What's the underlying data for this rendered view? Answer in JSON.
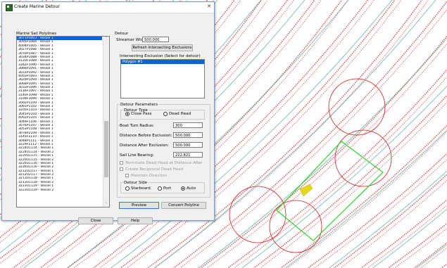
{
  "dialog": {
    "title": "Create Marine Detour",
    "close_glyph": "✕",
    "lines_label": "Marine Sail Polylines",
    "lines": [
      "3071P1003 - Vessel 1",
      "3095F1084 - Vessel 1",
      "4004P1005 - Vessel 1",
      "3027P1086 - Vessel 1",
      "3070P1087 - Vessel 1",
      "3034P1088 - Vessel 1",
      "3120F1089 - Vessel 1",
      "3162F1090 - Vessel 1",
      "3066P1091 - Vessel 1",
      "3031P1092 - Vessel 1",
      "4003P1093 - Vessel 1",
      "3029P1094 - Vessel 1",
      "3068P1095 - Vessel 1",
      "3033P1096 - Vessel 1",
      "3116F1097 - Vessel 1",
      "3140F1098 - Vessel 1",
      "3109F1099 - Vessel 1",
      "3002P1100 - Vessel 1",
      "3065P1102 - Vessel 1",
      "3205F1103 - Vessel 1",
      "3045P2104 - Vessel 1",
      "4002P1105 - Vessel 1",
      "3049F1106 - Vessel 1",
      "3076P1107 - Vessel 1",
      "3053P1108 - Vessel 1",
      "3078P2109 - Vessel 1",
      "3145F1110 - Vessel 1",
      "3048P1111 - Vessel 1",
      "3229F1112 - Vessel 1",
      "3224U1114 - Vessel 1",
      "3224U1114 - Vessel 2",
      "3220U1115 - Vessel 1",
      "3220U1115 - Vessel 2",
      "3226U1116 - Vessel 1",
      "3226U1116 - Vessel 2",
      "3212U2117 - Vessel 1",
      "3212U2117 - Vessel 2",
      "3213U1118 - Vessel 1",
      "3213U1118 - Vessel 2",
      "3223U1119 - Vessel 1",
      "3223U1119 - Vessel 2"
    ],
    "scroll_up": "˄",
    "scroll_down": "˅",
    "detour_label": "Detour",
    "streamer_width_label": "Streamer Width:",
    "streamer_width_value": "500.000",
    "refresh_button": "Refresh Intersecting Exclusions",
    "intersecting_label": "Intersecting Exclusion (Select for detour)",
    "exclusions": [
      "Polygon #1"
    ],
    "params_label": "Detour Parameters",
    "detour_type_label": "Detour Type",
    "close_pass_label": "Close Pass",
    "dead_head_label": "Dead Head",
    "boat_turn_label": "Boat Turn Radius:",
    "boat_turn_value": "300",
    "dist_before_label": "Distance Before Exclusion:",
    "dist_before_value": "500.000",
    "dist_after_label": "Distance After Exclusion:",
    "dist_after_value": "500.000",
    "bearing_label": "Sail Line Bearing:",
    "bearing_value": "222.821",
    "terminate_label": "Terminate Dead Head at Distance After",
    "reciprocal_label": "Create Reciprocal Dead Head",
    "maintain_label": "Maintain Direction",
    "side_label": "Detour Side",
    "starboard_label": "Starboard",
    "port_label": "Port",
    "auto_label": "Auto",
    "preview_button": "Preview",
    "convert_button": "Convert Polyline",
    "close_button": "Close",
    "help_button": "Help"
  },
  "colors": {
    "sail_line": "#d21e1e",
    "teal_line": "#2a9a8a",
    "exclusion_polygon": "#2ad12a",
    "circle": "#d21e1e",
    "obstacle": "#e8d81a",
    "selection": "#0a64d8"
  }
}
